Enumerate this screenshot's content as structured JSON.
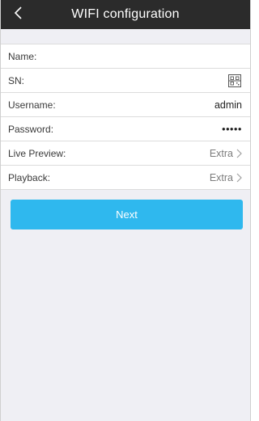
{
  "header": {
    "title": "WIFI configuration",
    "back_icon": "chevron-left-icon"
  },
  "form": {
    "rows": [
      {
        "label": "Name:",
        "value": ""
      },
      {
        "label": "SN:",
        "value": "",
        "icon": "qr-scan-icon"
      },
      {
        "label": "Username:",
        "value": "admin"
      },
      {
        "label": "Password:",
        "value": "•••••"
      },
      {
        "label": "Live Preview:",
        "value": "Extra",
        "icon": "chevron-right-icon"
      },
      {
        "label": "Playback:",
        "value": "Extra",
        "icon": "chevron-right-icon"
      }
    ]
  },
  "actions": {
    "next_label": "Next"
  },
  "colors": {
    "navbar": "#2b2b2b",
    "background": "#efeff4",
    "accent": "#2fb8ee"
  }
}
